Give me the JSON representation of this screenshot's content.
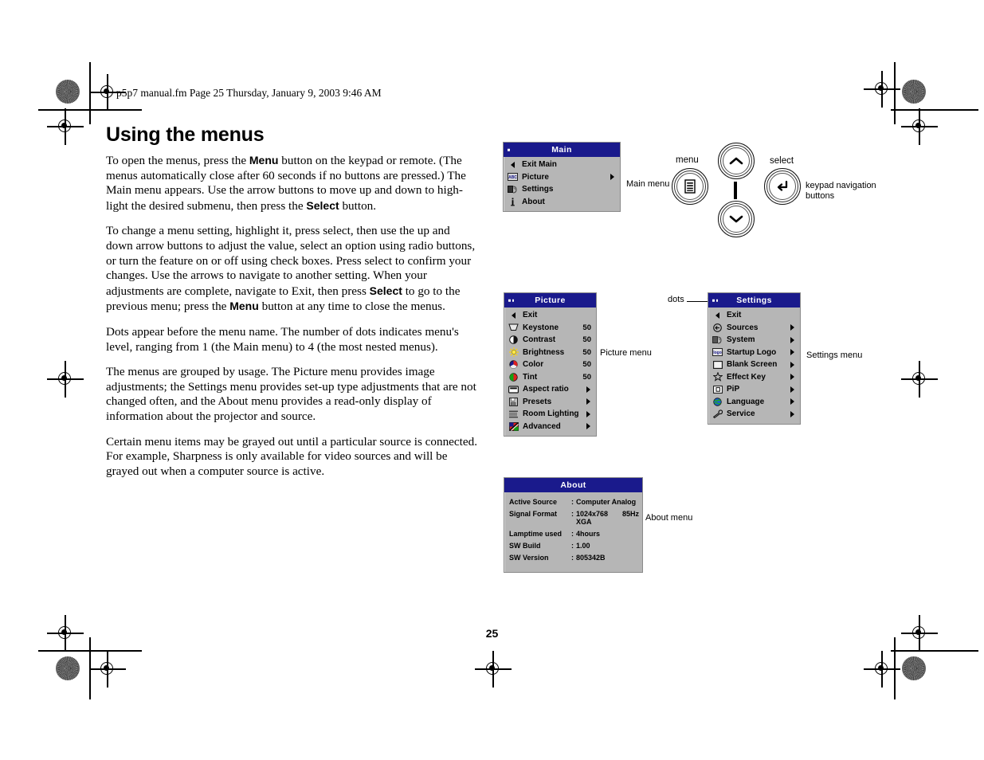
{
  "document": {
    "slug": "p5p7 manual.fm  Page 25  Thursday, January 9, 2003  9:46 AM",
    "title": "Using the menus",
    "page_number": "25",
    "paragraphs": [
      "To open the menus, press the <b>Menu</b> button on the keypad or remote. (The menus automatically close after 60 seconds if no buttons are pressed.) The Main menu appears. Use the arrow buttons to move up and down to high-light the desired submenu, then press the <b>Select</b> button.",
      "To change a menu setting, highlight it, press select, then use the up and down arrow buttons to adjust the value, select an option using radio buttons, or turn the feature on or off using check boxes. Press select to confirm your changes. Use the arrows to navigate to another setting. When your adjustments are complete, navigate to Exit, then press <b>Select</b> to go to the previous menu; press the <b>Menu</b> button at any time to close the menus.",
      "Dots appear before the menu name. The number of dots indicates menu's level, ranging from 1 (the Main menu) to 4 (the most nested menus).",
      "The menus are grouped by usage. The Picture menu provides image adjustments; the Settings menu provides set-up type adjustments that are not changed often, and the About menu provides a read-only display of information about the projector and source.",
      "Certain menu items may be grayed out until a particular source is connected. For example, Sharpness is only available for video sources and will be grayed out when a computer source is active."
    ]
  },
  "colors": {
    "osd_titlebar": "#1a1a8c",
    "osd_background": "#b6b6b6",
    "osd_text": "#000000",
    "osd_title_text": "#ffffff"
  },
  "main_menu": {
    "title": "Main",
    "dots": 1,
    "callout": "Main menu",
    "items": [
      {
        "icon": "left-arrow-icon",
        "label": "Exit Main",
        "submenu": false
      },
      {
        "icon": "picture-abc-icon",
        "label": "Picture",
        "submenu": true
      },
      {
        "icon": "settings-icon",
        "label": "Settings",
        "submenu": false
      },
      {
        "icon": "info-icon",
        "label": "About",
        "submenu": false
      }
    ]
  },
  "picture_menu": {
    "title": "Picture",
    "dots": 2,
    "callout": "Picture menu",
    "items": [
      {
        "icon": "left-arrow-icon",
        "label": "Exit",
        "value": "",
        "submenu": false
      },
      {
        "icon": "keystone-icon",
        "label": "Keystone",
        "value": "50",
        "submenu": false
      },
      {
        "icon": "contrast-icon",
        "label": "Contrast",
        "value": "50",
        "submenu": false
      },
      {
        "icon": "brightness-icon",
        "label": "Brightness",
        "value": "50",
        "submenu": false
      },
      {
        "icon": "color-icon",
        "label": "Color",
        "value": "50",
        "submenu": false
      },
      {
        "icon": "tint-icon",
        "label": "Tint",
        "value": "50",
        "submenu": false
      },
      {
        "icon": "aspect-ratio-icon",
        "label": "Aspect ratio",
        "value": "",
        "submenu": true
      },
      {
        "icon": "presets-icon",
        "label": "Presets",
        "value": "",
        "submenu": true
      },
      {
        "icon": "room-lighting-icon",
        "label": "Room Lighting",
        "value": "",
        "submenu": true
      },
      {
        "icon": "advanced-icon",
        "label": "Advanced",
        "value": "",
        "submenu": true
      }
    ]
  },
  "settings_menu": {
    "title": "Settings",
    "dots": 2,
    "callout": "Settings menu",
    "dots_callout": "dots",
    "items": [
      {
        "icon": "left-arrow-icon",
        "label": "Exit",
        "submenu": false
      },
      {
        "icon": "sources-icon",
        "label": "Sources",
        "submenu": true
      },
      {
        "icon": "system-icon",
        "label": "System",
        "submenu": true
      },
      {
        "icon": "startup-logo-icon",
        "label": "Startup Logo",
        "submenu": true
      },
      {
        "icon": "blank-screen-icon",
        "label": "Blank Screen",
        "submenu": true
      },
      {
        "icon": "effect-key-icon",
        "label": "Effect Key",
        "submenu": true
      },
      {
        "icon": "pip-icon",
        "label": "PiP",
        "submenu": true
      },
      {
        "icon": "language-icon",
        "label": "Language",
        "submenu": true
      },
      {
        "icon": "service-icon",
        "label": "Service",
        "submenu": true
      }
    ]
  },
  "about_menu": {
    "title": "About",
    "callout": "About menu",
    "rows": [
      {
        "key": "Active  Source",
        "sep": ":",
        "value": "Computer Analog",
        "value2": ""
      },
      {
        "key": "Signal  Format",
        "sep": ":",
        "value": "1024x768 XGA",
        "value2": "85Hz"
      },
      {
        "key": "Lamptime  used",
        "sep": ":",
        "value": "4hours",
        "value2": ""
      },
      {
        "key": "SW  Build",
        "sep": ":",
        "value": "1.00",
        "value2": ""
      },
      {
        "key": "SW  Version",
        "sep": ":",
        "value": "805342B",
        "value2": ""
      }
    ]
  },
  "keypad": {
    "menu_label": "menu",
    "select_label": "select",
    "caption_line1": "keypad navigation",
    "caption_line2": "buttons",
    "buttons": [
      {
        "name": "menu-button",
        "icon": "menu-lines-icon"
      },
      {
        "name": "up-button",
        "icon": "chevron-up-icon"
      },
      {
        "name": "down-button",
        "icon": "chevron-down-icon"
      },
      {
        "name": "select-button",
        "icon": "enter-arrow-icon"
      }
    ]
  }
}
